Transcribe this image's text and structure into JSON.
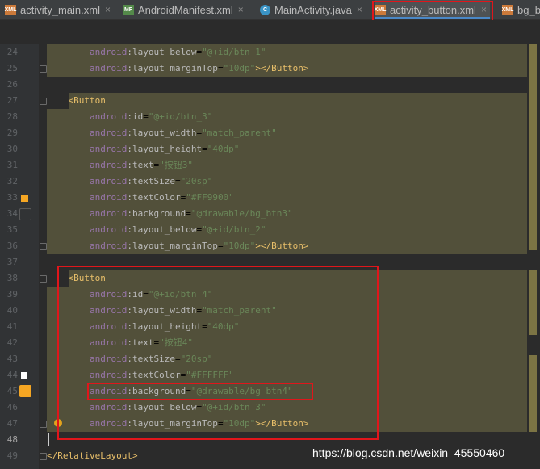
{
  "tabs": [
    {
      "icon": "xml-file-icon",
      "badge": "XML",
      "label": "activity_main.xml"
    },
    {
      "icon": "manifest-file-icon",
      "badge": "MF",
      "label": "AndroidManifest.xml"
    },
    {
      "icon": "java-class-icon",
      "badge": "C",
      "label": "MainActivity.java"
    },
    {
      "icon": "xml-file-icon",
      "badge": "XML",
      "label": "activity_button.xml",
      "active": true
    },
    {
      "icon": "xml-file-icon",
      "badge": "XML",
      "label": "bg_b"
    }
  ],
  "close_glyph": "×",
  "lines": [
    {
      "n": "24",
      "indent": "        ",
      "name": "android:layout_below",
      "value": "\"@+id/btn_1\"",
      "tail": ""
    },
    {
      "n": "25",
      "indent": "        ",
      "name": "android:layout_marginTop",
      "value": "\"10dp\"",
      "tail": "></Button>"
    },
    {
      "n": "26",
      "text": ""
    },
    {
      "n": "27",
      "indent": "    ",
      "tag": "<Button"
    },
    {
      "n": "28",
      "indent": "        ",
      "name": "android:id",
      "value": "\"@+id/btn_3\"",
      "tail": ""
    },
    {
      "n": "29",
      "indent": "        ",
      "name": "android:layout_width",
      "value": "\"match_parent\"",
      "tail": ""
    },
    {
      "n": "30",
      "indent": "        ",
      "name": "android:layout_height",
      "value": "\"40dp\"",
      "tail": ""
    },
    {
      "n": "31",
      "indent": "        ",
      "name": "android:text",
      "value": "\"按钮3\"",
      "tail": ""
    },
    {
      "n": "32",
      "indent": "        ",
      "name": "android:textSize",
      "value": "\"20sp\"",
      "tail": ""
    },
    {
      "n": "33",
      "indent": "        ",
      "name": "android:textColor",
      "value": "\"#FF9900\"",
      "tail": ""
    },
    {
      "n": "34",
      "indent": "        ",
      "name": "android:background",
      "value": "\"@drawable/bg_btn3\"",
      "tail": ""
    },
    {
      "n": "35",
      "indent": "        ",
      "name": "android:layout_below",
      "value": "\"@+id/btn_2\"",
      "tail": ""
    },
    {
      "n": "36",
      "indent": "        ",
      "name": "android:layout_marginTop",
      "value": "\"10dp\"",
      "tail": "></Button>"
    },
    {
      "n": "37",
      "text": ""
    },
    {
      "n": "38",
      "indent": "    ",
      "tag": "<Button"
    },
    {
      "n": "39",
      "indent": "        ",
      "name": "android:id",
      "value": "\"@+id/btn_4\"",
      "tail": ""
    },
    {
      "n": "40",
      "indent": "        ",
      "name": "android:layout_width",
      "value": "\"match_parent\"",
      "tail": ""
    },
    {
      "n": "41",
      "indent": "        ",
      "name": "android:layout_height",
      "value": "\"40dp\"",
      "tail": ""
    },
    {
      "n": "42",
      "indent": "        ",
      "name": "android:text",
      "value": "\"按钮4\"",
      "tail": ""
    },
    {
      "n": "43",
      "indent": "        ",
      "name": "android:textSize",
      "value": "\"20sp\"",
      "tail": ""
    },
    {
      "n": "44",
      "indent": "        ",
      "name": "android:textColor",
      "value": "\"#FFFFFF\"",
      "tail": ""
    },
    {
      "n": "45",
      "indent": "        ",
      "name": "android:background",
      "value": "\"@drawable/bg_btn4\"",
      "tail": ""
    },
    {
      "n": "46",
      "indent": "        ",
      "name": "android:layout_below",
      "value": "\"@+id/btn_3\"",
      "tail": ""
    },
    {
      "n": "47",
      "indent": "        ",
      "name": "android:layout_marginTop",
      "value": "\"10dp\"",
      "tail": "></Button>"
    },
    {
      "n": "48",
      "text": ""
    },
    {
      "n": "49",
      "tag": "</RelativeLayout>"
    }
  ],
  "gutter_markers": {
    "33": "color-swatch-orange-icon",
    "34": "color-swatch-empty-icon",
    "44": "color-swatch-white-icon",
    "45": "drawable-preview-icon",
    "47": "intention-bulb-icon"
  },
  "colors": {
    "tag": "#e8bf6a",
    "attr_namespace": "#9876aa",
    "attr_name": "#bababa",
    "attr_value": "#6a8759",
    "line_highlight": "#52503a",
    "annotation": "#e0161b"
  },
  "watermark": "https://blog.csdn.net/weixin_45550460"
}
